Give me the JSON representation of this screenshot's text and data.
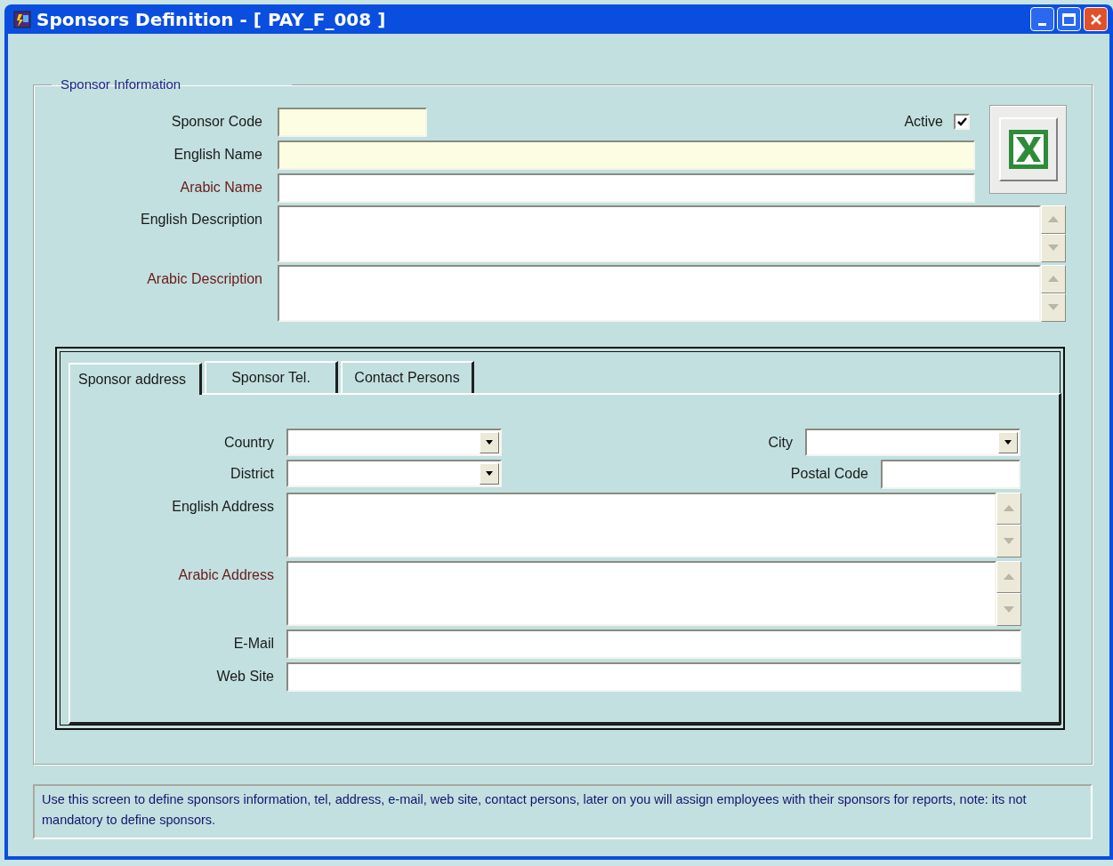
{
  "window": {
    "title": "Sponsors Definition - [ PAY_F_008 ]"
  },
  "group": {
    "legend": "Sponsor Information"
  },
  "active": {
    "label": "Active",
    "checked": true
  },
  "fields": [
    {
      "label": "Sponsor Code",
      "kind": "short_text",
      "required": true,
      "color": "#1a1a1a"
    },
    {
      "label": "English Name",
      "kind": "text",
      "required": true,
      "color": "#1a1a1a"
    },
    {
      "label": "Arabic Name",
      "kind": "text",
      "required": false,
      "color": "#6b1a1a"
    },
    {
      "label": "English Description",
      "kind": "memo",
      "required": false,
      "color": "#1a1a1a"
    },
    {
      "label": "Arabic Description",
      "kind": "memo",
      "required": false,
      "color": "#6b1a1a"
    }
  ],
  "tabs": [
    {
      "label": "Sponsor address",
      "selected": true
    },
    {
      "label": "Sponsor Tel.",
      "selected": false
    },
    {
      "label": "Contact Persons",
      "selected": false
    }
  ],
  "address": {
    "rows": [
      {
        "items": [
          {
            "label": "Country",
            "kind": "dropdown",
            "color": "#1a1a1a"
          },
          {
            "label": "City",
            "kind": "dropdown",
            "color": "#1a1a1a"
          }
        ]
      },
      {
        "items": [
          {
            "label": "District",
            "kind": "dropdown",
            "color": "#1a1a1a"
          },
          {
            "label": "Postal Code",
            "kind": "short_text",
            "color": "#1a1a1a"
          }
        ]
      },
      {
        "items": [
          {
            "label": "English Address",
            "kind": "memo",
            "color": "#1a1a1a"
          }
        ]
      },
      {
        "items": [
          {
            "label": "Arabic Address",
            "kind": "memo",
            "color": "#6b1a1a"
          }
        ]
      },
      {
        "items": [
          {
            "label": "E-Mail",
            "kind": "text",
            "color": "#1a1a1a"
          }
        ]
      },
      {
        "items": [
          {
            "label": "Web Site",
            "kind": "text",
            "color": "#1a1a1a"
          }
        ]
      }
    ]
  },
  "help": "Use this screen to define sponsors information, tel, address, e-mail, web site, contact persons, later on you will assign employees with their sponsors for reports, note: its not mandatory to define sponsors."
}
